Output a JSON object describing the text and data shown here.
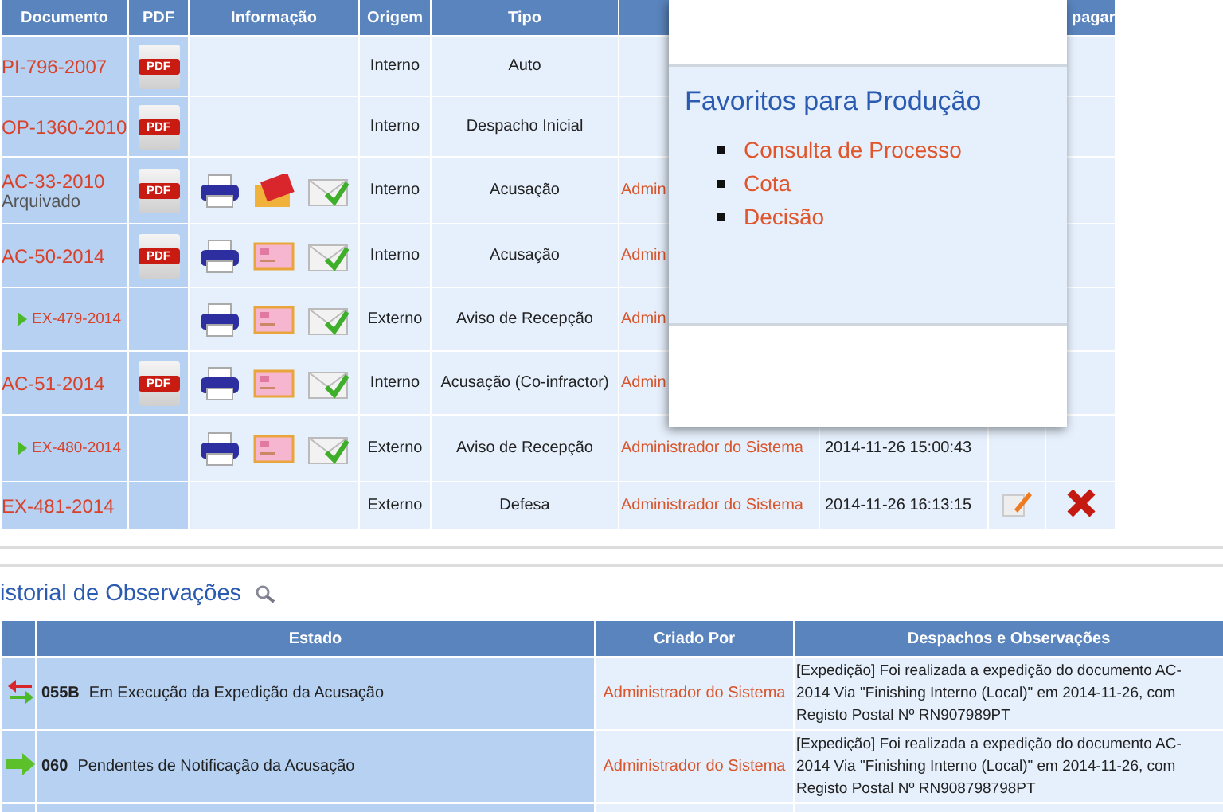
{
  "documents": {
    "columns": [
      {
        "label": "Documento"
      },
      {
        "label": "PDF"
      },
      {
        "label": "Informação"
      },
      {
        "label": "Origem"
      },
      {
        "label": "Tipo"
      },
      {},
      {},
      {},
      {
        "label": "pagar"
      }
    ],
    "rows": [
      {
        "document": "PI-796-2007",
        "kind": "main",
        "pdf": "PDF",
        "info": [],
        "origin": "Interno",
        "type": "Auto",
        "actions": []
      },
      {
        "document": "OP-1360-2010",
        "kind": "main",
        "pdf": "PDF",
        "info": [],
        "origin": "Interno",
        "type": "Despacho Inicial",
        "actions": []
      },
      {
        "document": "AC-33-2010",
        "note": "Arquivado",
        "kind": "main",
        "pdf": "PDF",
        "info": [
          {
            "kind": "printer"
          },
          {
            "kind": "letter"
          },
          {
            "kind": "check"
          }
        ],
        "origin": "Interno",
        "type": "Acusação",
        "creator": "Admin",
        "actions": []
      },
      {
        "document": "AC-50-2014",
        "kind": "main",
        "pdf": "PDF",
        "info": [
          {
            "kind": "printer"
          },
          {
            "kind": "card"
          },
          {
            "kind": "check"
          }
        ],
        "origin": "Interno",
        "type": "Acusação",
        "creator": "Admin",
        "actions": []
      },
      {
        "document": "EX-479-2014",
        "kind": "sub",
        "info": [
          {
            "kind": "printer"
          },
          {
            "kind": "card"
          },
          {
            "kind": "check"
          }
        ],
        "origin": "Externo",
        "type": "Aviso de Recepção",
        "creator": "Admin",
        "actions": []
      },
      {
        "document": "AC-51-2014",
        "kind": "main",
        "pdf": "PDF",
        "info": [
          {
            "kind": "printer"
          },
          {
            "kind": "card"
          },
          {
            "kind": "check"
          }
        ],
        "origin": "Interno",
        "type": "Acusação (Co-infractor)",
        "creator": "Admin",
        "actions": []
      },
      {
        "document": "EX-480-2014",
        "kind": "sub",
        "info": [
          {
            "kind": "printer"
          },
          {
            "kind": "card"
          },
          {
            "kind": "check"
          }
        ],
        "origin": "Externo",
        "type": "Aviso de Recepção",
        "creator": "Administrador do Sistema",
        "date": "2014-11-26 15:00:43",
        "actions": []
      },
      {
        "document": "EX-481-2014",
        "kind": "main",
        "info": [],
        "origin": "Externo",
        "type": "Defesa",
        "creator": "Administrador do Sistema",
        "date": "2014-11-26 16:13:15",
        "actions": [
          {
            "kind": "edit"
          },
          {
            "kind": "delete"
          }
        ]
      }
    ]
  },
  "favorites": {
    "title": "Favoritos para Produção",
    "items": [
      "Consulta de Processo",
      "Cota",
      "Decisão"
    ]
  },
  "history": {
    "title": "istorial de Observações",
    "columns": [
      {},
      {
        "label": "Estado"
      },
      {
        "label": "Criado Por"
      },
      {
        "label": "Despachos e Observações"
      }
    ],
    "rows": [
      {
        "kind": "exchange",
        "code": "055B",
        "state": "Em Execução da Expedição da Acusação",
        "creator": "Administrador do Sistema",
        "notes": [
          "[Expedição] Foi realizada a expedição do documento AC-",
          "2014 Via \"Finishing Interno (Local)\" em 2014-11-26, com",
          "Registo Postal Nº RN907989PT"
        ]
      },
      {
        "kind": "forward",
        "code": "060",
        "state": "Pendentes de Notificação da Acusação",
        "creator": "Administrador do Sistema",
        "notes": [
          "[Expedição] Foi realizada a expedição do documento AC-",
          "2014 Via \"Finishing Interno (Local)\" em 2014-11-26, com",
          "Registo Postal Nº RN908798798PT"
        ]
      }
    ]
  }
}
